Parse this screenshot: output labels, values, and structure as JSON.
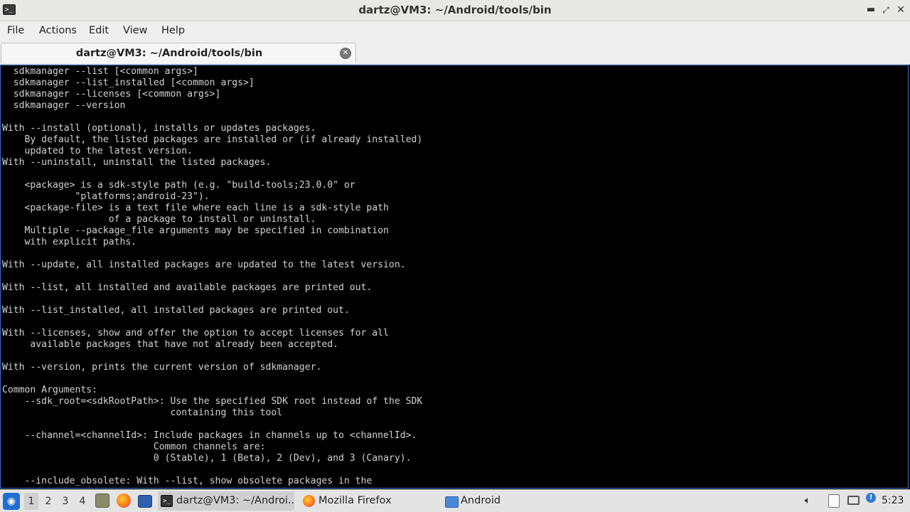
{
  "window": {
    "title": "dartz@VM3: ~/Android/tools/bin",
    "minimize_glyph": "▬",
    "maximize_glyph": "⤢",
    "close_glyph": "✕",
    "app_icon_glyph": ">_"
  },
  "menu": {
    "items": [
      "File",
      "Actions",
      "Edit",
      "View",
      "Help"
    ]
  },
  "tab": {
    "label": "dartz@VM3: ~/Android/tools/bin",
    "close_glyph": "✕"
  },
  "terminal": {
    "lines": [
      "  sdkmanager --list [<common args>]",
      "  sdkmanager --list_installed [<common args>]",
      "  sdkmanager --licenses [<common args>]",
      "  sdkmanager --version",
      "",
      "With --install (optional), installs or updates packages.",
      "    By default, the listed packages are installed or (if already installed)",
      "    updated to the latest version.",
      "With --uninstall, uninstall the listed packages.",
      "",
      "    <package> is a sdk-style path (e.g. \"build-tools;23.0.0\" or",
      "             \"platforms;android-23\").",
      "    <package-file> is a text file where each line is a sdk-style path",
      "                   of a package to install or uninstall.",
      "    Multiple --package_file arguments may be specified in combination",
      "    with explicit paths.",
      "",
      "With --update, all installed packages are updated to the latest version.",
      "",
      "With --list, all installed and available packages are printed out.",
      "",
      "With --list_installed, all installed packages are printed out.",
      "",
      "With --licenses, show and offer the option to accept licenses for all",
      "     available packages that have not already been accepted.",
      "",
      "With --version, prints the current version of sdkmanager.",
      "",
      "Common Arguments:",
      "    --sdk_root=<sdkRootPath>: Use the specified SDK root instead of the SDK",
      "                              containing this tool",
      "",
      "    --channel=<channelId>: Include packages in channels up to <channelId>.",
      "                           Common channels are:",
      "                           0 (Stable), 1 (Beta), 2 (Dev), and 3 (Canary).",
      "",
      "    --include_obsolete: With --list, show obsolete packages in the"
    ]
  },
  "taskbar": {
    "workspaces": [
      "1",
      "2",
      "3",
      "4"
    ],
    "active_workspace": "1",
    "quick_launch_icons": [
      "file-manager-icon",
      "firefox-icon",
      "show-desktop-icon"
    ],
    "tasks": [
      {
        "label": "dartz@VM3: ~/Androi...",
        "icon": "terminal-icon",
        "active": true
      },
      {
        "label": "Mozilla Firefox",
        "icon": "firefox-icon",
        "active": false
      },
      {
        "label": "Android",
        "icon": "folder-icon",
        "active": false
      }
    ],
    "tray_icons": [
      "volume-icon",
      "clipboard-icon",
      "network-icon",
      "update-notifier-icon"
    ],
    "clock": "5:23"
  }
}
